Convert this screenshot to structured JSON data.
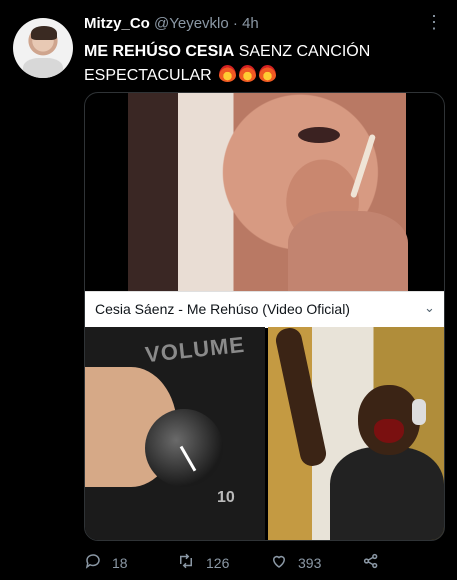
{
  "tweet": {
    "display_name": "Mitzy_Co",
    "handle": "@Yeyevklo",
    "separator": "·",
    "time": "4h",
    "text_bold": "ME REHÚSO CESIA",
    "text_rest": " SAENZ  CANCIÓN ESPECTACULAR",
    "emoji_count": 3
  },
  "media": {
    "video_title": "Cesia Sáenz - Me Rehúso (Video Oficial)",
    "volume_label": "VOLUME",
    "knob_number": "10"
  },
  "actions": {
    "replies": "18",
    "retweets": "126",
    "likes": "393"
  },
  "icons": [
    "more-icon",
    "reply-icon",
    "retweet-icon",
    "like-icon",
    "share-icon",
    "chevron-down-icon",
    "fire-emoji"
  ]
}
